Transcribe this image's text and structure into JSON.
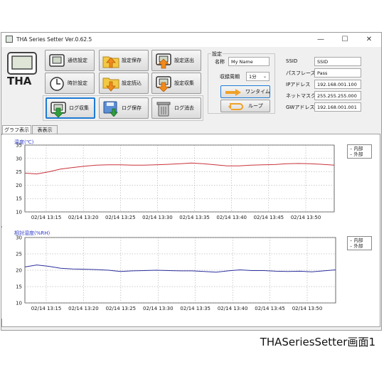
{
  "window": {
    "title": "THA Series Setter Ver.0.62.5",
    "minimize": "—",
    "maximize": "☐",
    "close": "✕"
  },
  "logo": {
    "text": "THA"
  },
  "buttons": {
    "comm_settings": "通信設定",
    "save_settings": "設定保存",
    "send_settings": "設定送出",
    "clock_settings": "時計設定",
    "load_settings": "設定読込",
    "collect_settings": "設定収集",
    "log_collect": "ログ収集",
    "log_save": "ログ保存",
    "log_delete": "ログ消去"
  },
  "settings": {
    "group_label": "設定",
    "name_label": "名称",
    "name_value": "My Name",
    "interval_label": "収録周期",
    "interval_value": "1分",
    "oneshot_label": "ワンタイム",
    "loop_label": "ループ"
  },
  "network": {
    "ssid_label": "SSID",
    "ssid_value": "SSID",
    "pass_label": "パスフレーズ",
    "pass_value": "Pass",
    "ip_label": "IPアドレス",
    "ip_value": "192.168.001.100",
    "mask_label": "ネットマスク",
    "mask_value": "255.255.255.000",
    "gw_label": "GWアドレス",
    "gw_value": "192.168.001.001"
  },
  "tabs": [
    {
      "label": "グラフ表示"
    },
    {
      "label": "表表示"
    }
  ],
  "colors": {
    "inner": "#c8323a",
    "outer": "#2d2f9e",
    "accent": "#1e7bd4"
  },
  "caption": "THASeriesSetter画面1",
  "chart_data": [
    {
      "type": "line",
      "title": "温度(℃)",
      "xlabel": "",
      "ylabel": "",
      "ylim": [
        10,
        35
      ],
      "yticks": [
        10,
        15,
        20,
        25,
        30,
        35
      ],
      "xticks": [
        "02/14 13:15",
        "02/14 13:20",
        "02/14 13:25",
        "02/14 13:30",
        "02/14 13:35",
        "02/14 13:40",
        "02/14 13:45",
        "02/14 13:50"
      ],
      "grid": true,
      "legend_position": "top-right",
      "legend": [
        "内部",
        "外部"
      ],
      "series": [
        {
          "name": "内部",
          "values": [
            24.5,
            24.2,
            25.0,
            26.0,
            26.6,
            27.1,
            27.5,
            27.6,
            27.6,
            27.5,
            27.5,
            27.6,
            27.8,
            28.0,
            28.3,
            28.0,
            27.6,
            27.2,
            27.2,
            27.5,
            27.6,
            27.7,
            28.0,
            28.1,
            28.0,
            27.8,
            27.5
          ]
        }
      ]
    },
    {
      "type": "line",
      "title": "相対湿度(%RH)",
      "xlabel": "",
      "ylabel": "",
      "ylim": [
        10,
        30
      ],
      "yticks": [
        10,
        15,
        20,
        25,
        30
      ],
      "xticks": [
        "02/14 13:15",
        "02/14 13:20",
        "02/14 13:25",
        "02/14 13:30",
        "02/14 13:35",
        "02/14 13:40",
        "02/14 13:45",
        "02/14 13:50"
      ],
      "grid": true,
      "legend_position": "top-right",
      "legend": [
        "内部",
        "外部"
      ],
      "series": [
        {
          "name": "内部",
          "values": [
            21.0,
            21.6,
            21.2,
            20.6,
            20.4,
            20.3,
            20.2,
            20.0,
            19.6,
            19.8,
            19.9,
            20.0,
            19.9,
            19.8,
            19.8,
            19.6,
            19.4,
            19.8,
            20.1,
            19.9,
            19.9,
            19.7,
            19.6,
            19.7,
            19.5,
            19.8,
            20.1
          ]
        }
      ]
    }
  ]
}
